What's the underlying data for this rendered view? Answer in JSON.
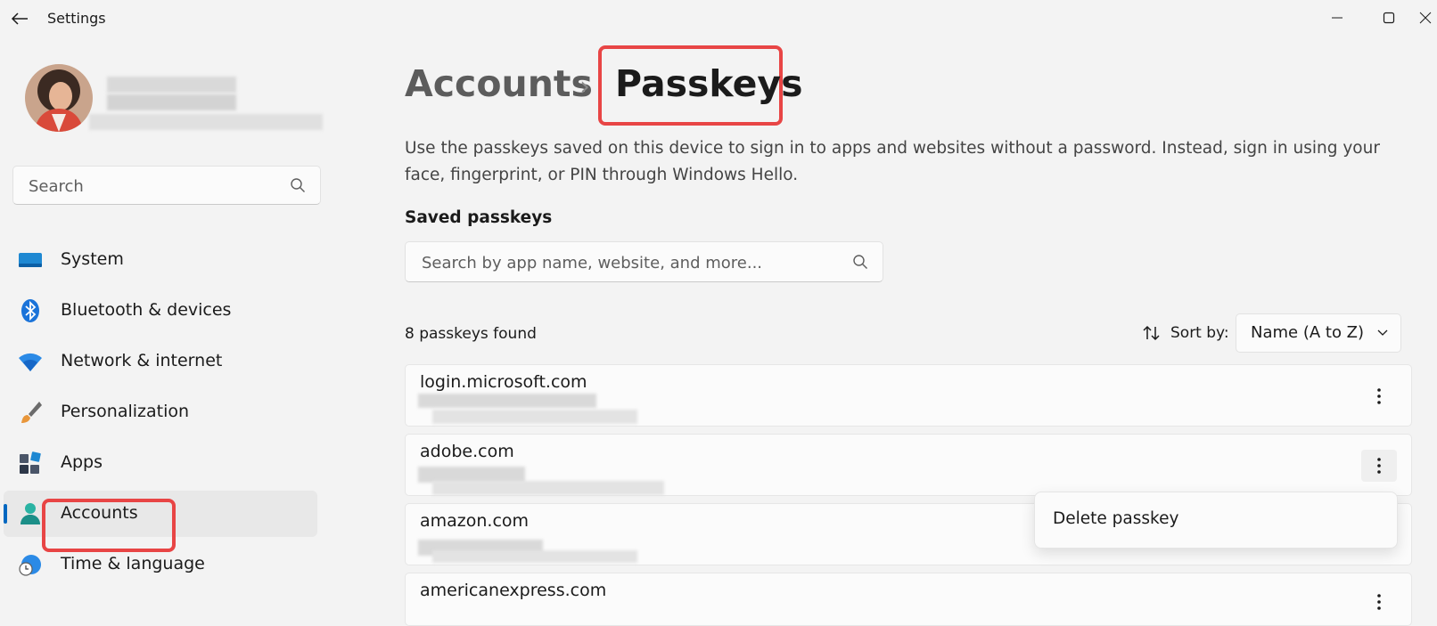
{
  "app": {
    "title": "Settings"
  },
  "sidebar": {
    "search_placeholder": "Search",
    "items": [
      {
        "label": "System",
        "icon": "monitor-icon"
      },
      {
        "label": "Bluetooth & devices",
        "icon": "bluetooth-icon"
      },
      {
        "label": "Network & internet",
        "icon": "wifi-icon"
      },
      {
        "label": "Personalization",
        "icon": "paintbrush-icon"
      },
      {
        "label": "Apps",
        "icon": "apps-icon"
      },
      {
        "label": "Accounts",
        "icon": "account-icon",
        "selected": true
      },
      {
        "label": "Time & language",
        "icon": "clock-globe-icon"
      }
    ]
  },
  "breadcrumb": {
    "root": "Accounts",
    "separator": "›",
    "current": "Passkeys"
  },
  "description": "Use the passkeys saved on this device to sign in to apps and websites without a password. Instead, sign in using your face, fingerprint, or PIN through Windows Hello.",
  "saved": {
    "title": "Saved passkeys",
    "search_placeholder": "Search by app name, website, and more...",
    "count_text": "8 passkeys found",
    "sort_label": "Sort by:",
    "sort_value": "Name (A to Z)",
    "items": [
      {
        "site": "login.microsoft.com"
      },
      {
        "site": "adobe.com"
      },
      {
        "site": "amazon.com"
      },
      {
        "site": "americanexpress.com"
      }
    ]
  },
  "context_menu": {
    "item": "Delete passkey"
  },
  "colors": {
    "accent": "#0067c0",
    "highlight": "#e84545"
  }
}
